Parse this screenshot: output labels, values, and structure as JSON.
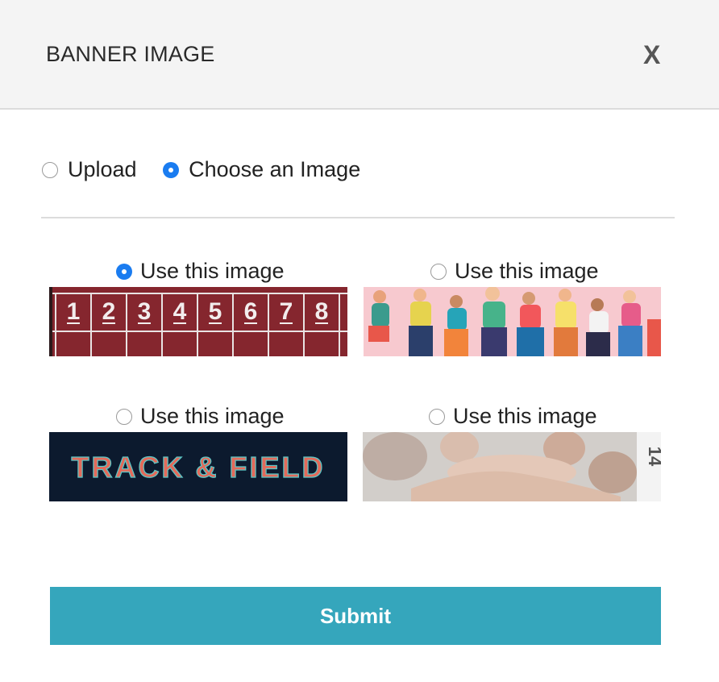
{
  "modal": {
    "title": "BANNER IMAGE",
    "close_label": "X"
  },
  "source_options": [
    {
      "label": "Upload",
      "selected": false
    },
    {
      "label": "Choose an Image",
      "selected": true
    }
  ],
  "images": [
    {
      "label": "Use this image",
      "selected": true,
      "name": "track-lanes-image",
      "lane_numbers": [
        "1",
        "2",
        "3",
        "4",
        "5",
        "6",
        "7",
        "8"
      ]
    },
    {
      "label": "Use this image",
      "selected": false,
      "name": "runners-illustration-image"
    },
    {
      "label": "Use this image",
      "selected": false,
      "name": "track-and-field-text-image",
      "text": "TRACK & FIELD"
    },
    {
      "label": "Use this image",
      "selected": false,
      "name": "team-hands-image",
      "bib_text": "14"
    }
  ],
  "submit_label": "Submit",
  "colors": {
    "accent": "#1a7cf0",
    "submit_bg": "#35a6bc",
    "header_bg": "#f4f4f4"
  }
}
